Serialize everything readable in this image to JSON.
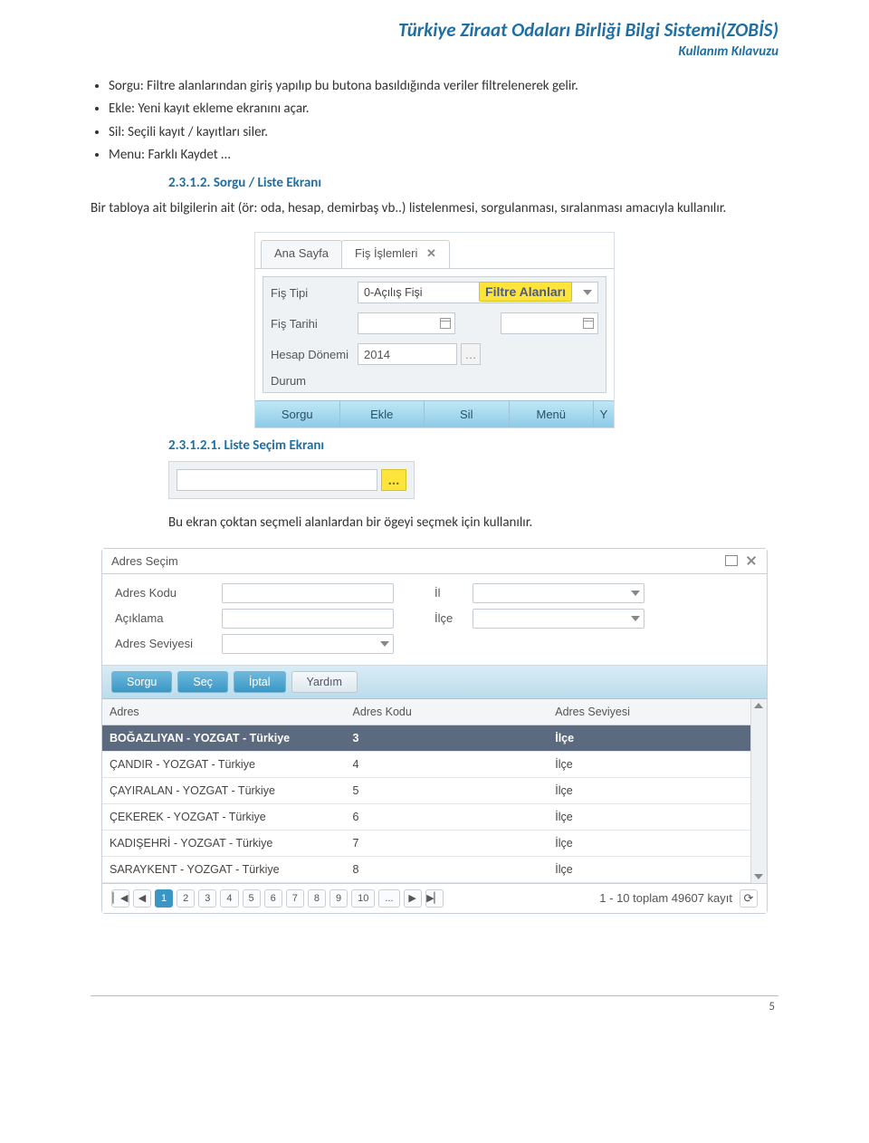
{
  "header": {
    "title": "Türkiye Ziraat Odaları Birliği Bilgi Sistemi(ZOBİS)",
    "subtitle": "Kullanım Kılavuzu"
  },
  "bullets": [
    "Sorgu: Filtre alanlarından giriş yapılıp bu butona basıldığında veriler filtrelenerek gelir.",
    "Ekle: Yeni kayıt ekleme ekranını açar.",
    "Sil: Seçili kayıt / kayıtları siler.",
    "Menu: Farklı Kaydet …"
  ],
  "section1": {
    "num": "2.3.1.2.",
    "title": "Sorgu / Liste Ekranı"
  },
  "para1": "Bir tabloya ait bilgilerin ait (ör: oda, hesap, demirbaş vb..) listelenmesi, sorgulanması, sıralanması amacıyla kullanılır.",
  "shot1": {
    "tabs": {
      "home": "Ana Sayfa",
      "fis": "Fiş İşlemleri",
      "close": "✕"
    },
    "labels": {
      "fisTipi": "Fiş Tipi",
      "fisTarihi": "Fiş Tarihi",
      "hesapDonemi": "Hesap Dönemi",
      "durum": "Durum"
    },
    "values": {
      "fisTipi": "0-Açılış Fişi",
      "hesapDonemi": "2014"
    },
    "highlight": "Filtre Alanları",
    "buttons": {
      "sorgu": "Sorgu",
      "ekle": "Ekle",
      "sil": "Sil",
      "menu": "Menü",
      "more": "Y"
    }
  },
  "section2": {
    "num": "2.3.1.2.1.",
    "title": "Liste Seçim Ekranı"
  },
  "lookup": {
    "btn": "..."
  },
  "para2": "Bu ekran çoktan seçmeli alanlardan bir ögeyi seçmek için kullanılır.",
  "shot2": {
    "title": "Adres Seçim",
    "form": {
      "adresKodu": "Adres Kodu",
      "aciklama": "Açıklama",
      "adresSeviyesi": "Adres Seviyesi",
      "il": "İl",
      "ilce": "İlçe"
    },
    "buttons": {
      "sorgu": "Sorgu",
      "sec": "Seç",
      "iptal": "İptal",
      "yardim": "Yardım"
    },
    "columns": {
      "adres": "Adres",
      "adresKodu": "Adres Kodu",
      "adresSeviyesi": "Adres Seviyesi"
    },
    "rows": [
      {
        "adres": "BOĞAZLIYAN - YOZGAT - Türkiye",
        "kod": "3",
        "seviye": "İlçe",
        "selected": true
      },
      {
        "adres": "ÇANDIR - YOZGAT - Türkiye",
        "kod": "4",
        "seviye": "İlçe"
      },
      {
        "adres": "ÇAYIRALAN - YOZGAT - Türkiye",
        "kod": "5",
        "seviye": "İlçe"
      },
      {
        "adres": "ÇEKEREK - YOZGAT - Türkiye",
        "kod": "6",
        "seviye": "İlçe"
      },
      {
        "adres": "KADIŞEHRİ - YOZGAT - Türkiye",
        "kod": "7",
        "seviye": "İlçe"
      },
      {
        "adres": "SARAYKENT - YOZGAT - Türkiye",
        "kod": "8",
        "seviye": "İlçe"
      }
    ],
    "pager": {
      "first": "▏◀",
      "prev": "◀",
      "next": "▶",
      "last": "▶▏",
      "pages": [
        "1",
        "2",
        "3",
        "4",
        "5",
        "6",
        "7",
        "8",
        "9",
        "10",
        "..."
      ],
      "summary": "1 - 10 toplam 49607 kayıt",
      "reload": "⟳"
    }
  },
  "pageNum": "5"
}
